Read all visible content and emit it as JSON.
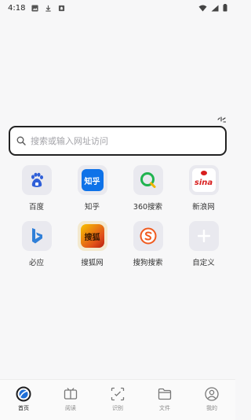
{
  "status_bar": {
    "time": "4:18",
    "left_icons": [
      "image-icon",
      "download-icon",
      "lock-icon"
    ],
    "right_icons": [
      "wifi-icon",
      "signal-icon",
      "battery-icon"
    ]
  },
  "search": {
    "placeholder": "搜索或输入网址访问"
  },
  "shortcuts": [
    {
      "label": "百度",
      "icon": "baidu-icon"
    },
    {
      "label": "知乎",
      "icon": "zhihu-icon",
      "icon_text": "知乎"
    },
    {
      "label": "360搜索",
      "icon": "360-search-icon"
    },
    {
      "label": "新浪网",
      "icon": "sina-icon",
      "icon_text": "sina"
    },
    {
      "label": "必应",
      "icon": "bing-icon"
    },
    {
      "label": "搜狐网",
      "icon": "sohu-icon",
      "icon_text": "搜狐"
    },
    {
      "label": "搜狗搜索",
      "icon": "sogou-icon"
    },
    {
      "label": "自定义",
      "icon": "plus-icon"
    }
  ],
  "nav": [
    {
      "label": "首页",
      "icon": "home-icon",
      "active": true
    },
    {
      "label": "阅读",
      "icon": "reading-icon"
    },
    {
      "label": "识别",
      "icon": "scan-icon"
    },
    {
      "label": "文件",
      "icon": "folder-icon"
    },
    {
      "label": "我的",
      "icon": "profile-icon"
    }
  ],
  "colors": {
    "background": "#f7f7f8",
    "tile": "#e9e9ef",
    "baidu_blue": "#2f5fd8",
    "zhihu_blue": "#0e72e8",
    "qihoo_green": "#20b34f",
    "sina_red": "#d81e1e",
    "bing_blue": "#2f7fd8",
    "sohu_orange": "#f0a000",
    "sogou_orange": "#f05a1e"
  }
}
